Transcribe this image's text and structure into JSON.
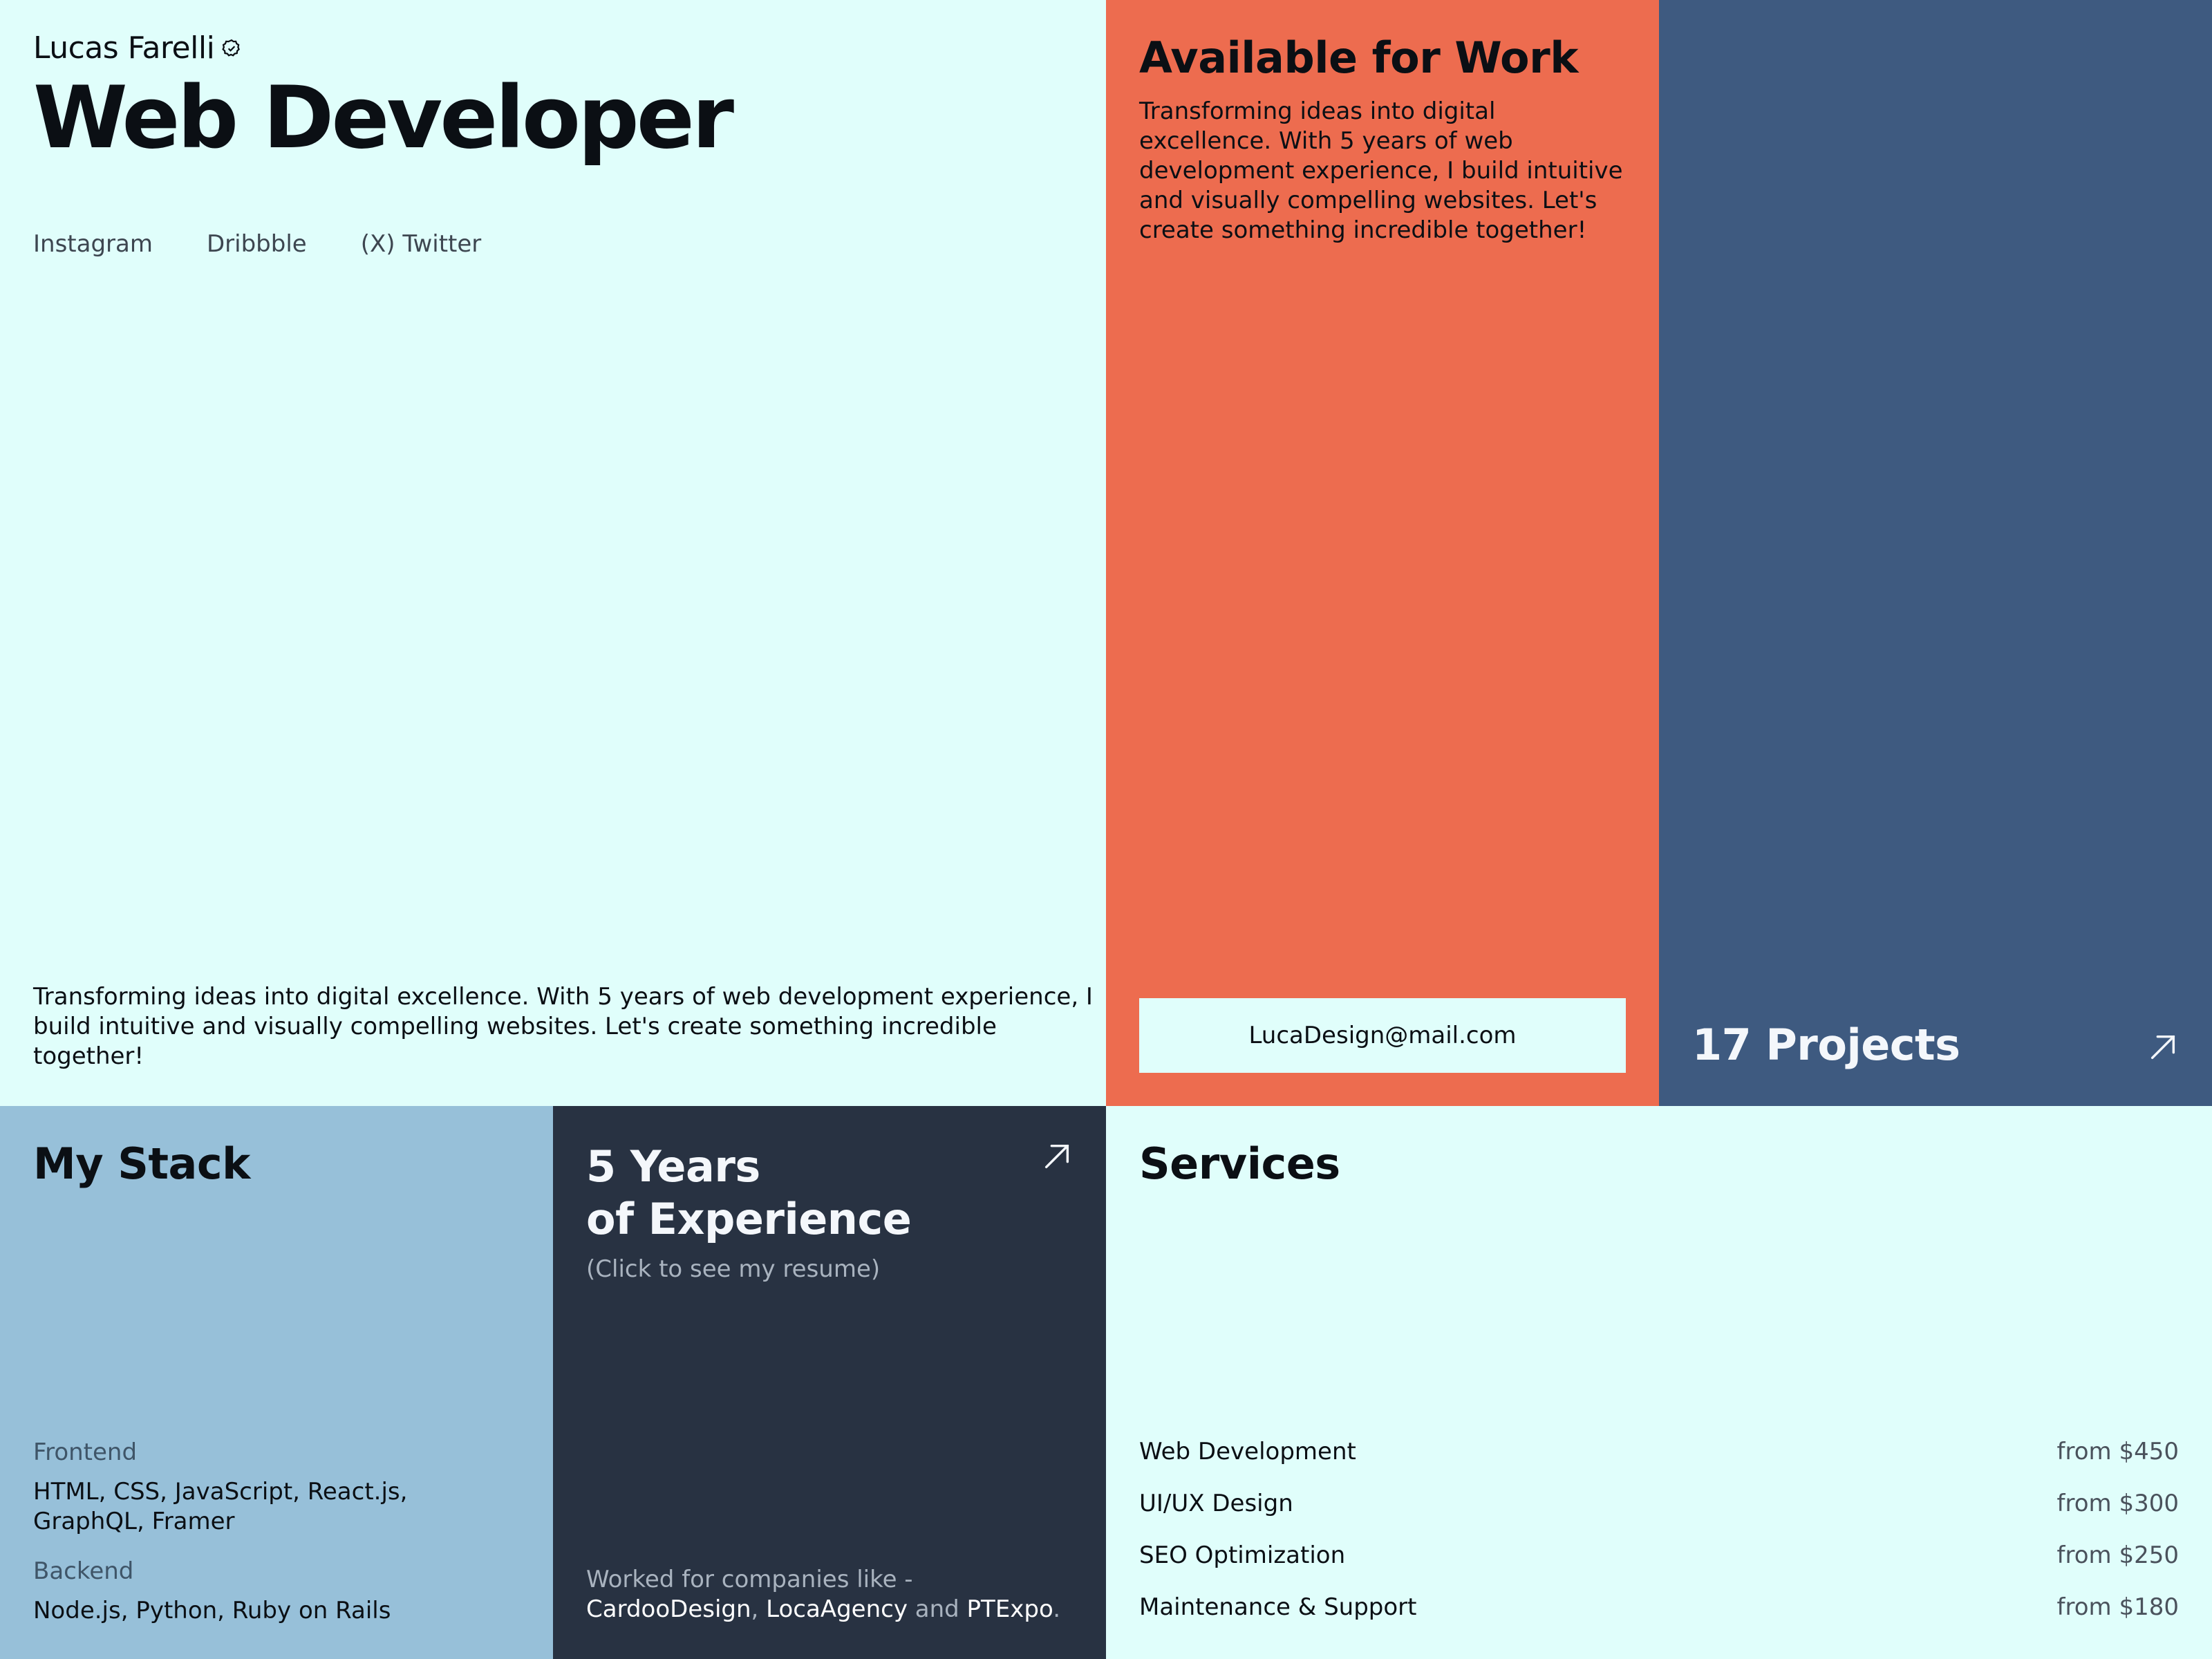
{
  "hero": {
    "name": "Lucas Farelli",
    "verified_icon": "verified-badge-icon",
    "headline": "Web Developer",
    "socials": [
      "Instagram",
      "Dribbble",
      "(X) Twitter"
    ],
    "bio": "Transforming ideas into digital excellence. With 5 years of web development experience, I build intuitive and visually compelling websites. Let's create something incredible together!"
  },
  "availability": {
    "title": "Available for Work",
    "description": "Transforming ideas into digital excellence. With 5 years of web development experience, I build intuitive and visually compelling websites. Let's create something incredible together!",
    "email": "LucaDesign@mail.com"
  },
  "projects": {
    "label": "17 Projects",
    "icon": "arrow-up-right-icon"
  },
  "stack": {
    "title": "My Stack",
    "categories": [
      {
        "name": "Frontend",
        "items": "HTML, CSS, JavaScript, React.js, GraphQL, Framer"
      },
      {
        "name": "Backend",
        "items": "Node.js, Python, Ruby on Rails"
      }
    ]
  },
  "experience": {
    "title_line1": "5 Years",
    "title_line2": "of Experience",
    "subtitle": "(Click to see my resume)",
    "icon": "arrow-up-right-icon",
    "companies_prefix": "Worked for companies like - ",
    "company_1": "CardooDesign",
    "sep_1": ", ",
    "company_2": "LocaAgency",
    "sep_2": " and ",
    "company_3": "PTExpo",
    "suffix": "."
  },
  "services": {
    "title": "Services",
    "items": [
      {
        "name": "Web Development",
        "price": "from $450"
      },
      {
        "name": "UI/UX Design",
        "price": "from $300"
      },
      {
        "name": "SEO Optimization",
        "price": "from $250"
      },
      {
        "name": "Maintenance & Support",
        "price": "from $180"
      }
    ]
  },
  "colors": {
    "mint": "#e0fefb",
    "coral": "#ed6c4f",
    "navy": "#3e5a80",
    "sky": "#97c0d9",
    "charcoal": "#283242"
  }
}
